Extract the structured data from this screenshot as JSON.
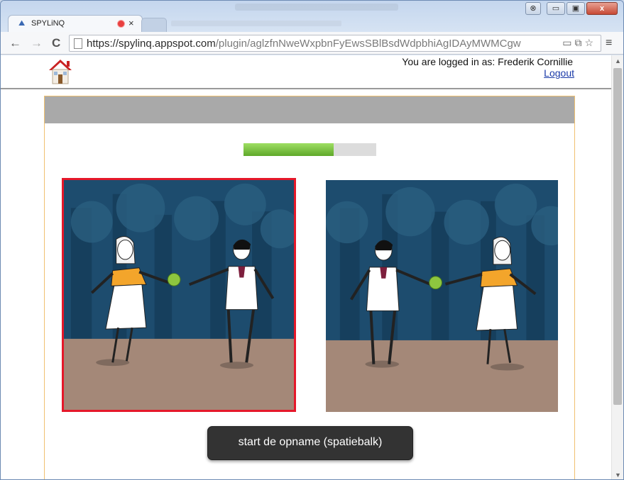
{
  "browser": {
    "tab_title": "SPYLiNQ",
    "tab_close_glyph": "×",
    "url_host": "https://spylinq.appspot.com",
    "url_path": "/plugin/aglzfnNweWxpbnFyEwsSBlBsdWdpbhiAgIDAyMWMCgw",
    "back_glyph": "←",
    "forward_glyph": "→",
    "reload_glyph": "C",
    "menu_glyph": "≡",
    "window_close_glyph": "x",
    "window_minimize_glyph": "▭",
    "window_maximize_glyph": "▣"
  },
  "header": {
    "logged_in_text": "You are logged in as: Frederik Cornillie",
    "logout_label": "Logout",
    "home_icon": "home-icon"
  },
  "exercise": {
    "progress_fraction": 0.68,
    "left_picture": "girl-gives-apple-to-boy",
    "right_picture": "boy-gives-apple-to-girl",
    "selected_picture": "left",
    "record_button_label": "start de opname (spatiebalk)"
  },
  "colors": {
    "selected_border": "#e5182a",
    "progress_fill": "#6fb537",
    "panel_border": "#f0c070",
    "panel_header": "#a9a9a9",
    "button_bg": "#333333"
  }
}
